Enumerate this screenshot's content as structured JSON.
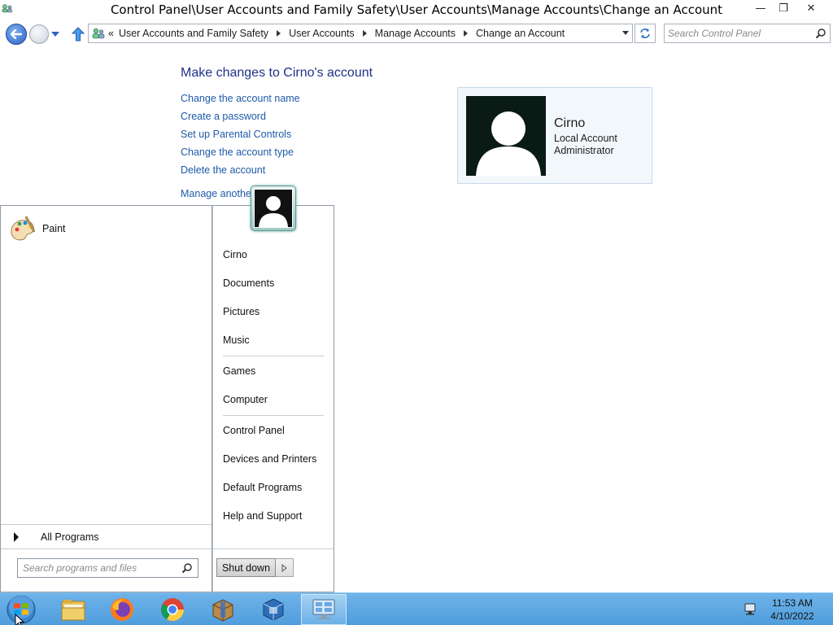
{
  "window": {
    "title": "Control Panel\\User Accounts and Family Safety\\User Accounts\\Manage Accounts\\Change an Account",
    "minimize_glyph": "—",
    "restore_glyph": "❐",
    "close_glyph": "✕"
  },
  "navigation": {
    "breadcrumb_prefix": "«",
    "breadcrumbs": [
      "User Accounts and Family Safety",
      "User Accounts",
      "Manage Accounts",
      "Change an Account"
    ],
    "search_placeholder": "Search Control Panel"
  },
  "content": {
    "page_title": "Make changes to Cirno's account",
    "tasks": [
      "Change the account name",
      "Create a password",
      "Set up Parental Controls",
      "Change the account type",
      "Delete the account",
      "Manage another account"
    ],
    "account": {
      "name": "Cirno",
      "type": "Local Account",
      "role": "Administrator"
    }
  },
  "start_menu": {
    "pinned_programs": [
      {
        "label": "Paint",
        "icon": "paint-icon"
      }
    ],
    "all_programs_label": "All Programs",
    "search_placeholder": "Search programs and files",
    "right_items": [
      "Cirno",
      "Documents",
      "Pictures",
      "Music",
      "Games",
      "Computer",
      "Control Panel",
      "Devices and Printers",
      "Default Programs",
      "Help and Support"
    ],
    "shutdown_label": "Shut down"
  },
  "taskbar": {
    "apps": [
      {
        "name": "file-explorer",
        "icon": "folder-icon"
      },
      {
        "name": "firefox",
        "icon": "firefox-icon"
      },
      {
        "name": "chrome",
        "icon": "chrome-icon"
      },
      {
        "name": "archive",
        "icon": "archive-icon"
      },
      {
        "name": "virtualbox",
        "icon": "virtualbox-icon"
      },
      {
        "name": "control-panel",
        "icon": "control-panel-icon",
        "active": true
      }
    ],
    "clock": {
      "time": "11:53 AM",
      "date": "4/10/2022"
    }
  },
  "colors": {
    "link": "#1e5aa8",
    "page_title": "#1e3287",
    "taskbar": "#5aa6e0",
    "card_bg": "#f2f7fc"
  }
}
